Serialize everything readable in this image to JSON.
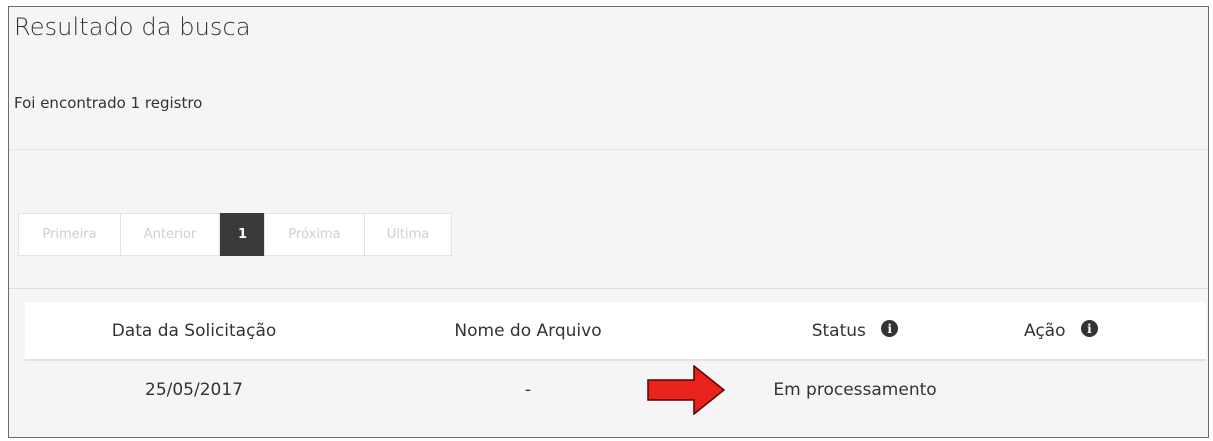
{
  "page": {
    "title": "Resultado da busca",
    "result_count": "Foi encontrado 1 registro"
  },
  "pagination": {
    "first": "Primeira",
    "previous": "Anterior",
    "current": "1",
    "next": "Próxima",
    "last": "Última"
  },
  "table": {
    "headers": {
      "date": "Data da Solicitação",
      "file": "Nome do Arquivo",
      "status": "Status",
      "action": "Ação"
    },
    "info_icon_glyph": "i",
    "rows": [
      {
        "date": "25/05/2017",
        "file": "-",
        "status": "Em processamento",
        "action": ""
      }
    ]
  },
  "annotation": {
    "arrow_color": "#e8221c",
    "arrow_outline": "#5a0000",
    "icon": "right-arrow-icon"
  },
  "colors": {
    "panel_background": "#f5f5f5",
    "pagination_active": "#3a3a3a",
    "pagination_disabled_text": "#cfcfcf"
  }
}
